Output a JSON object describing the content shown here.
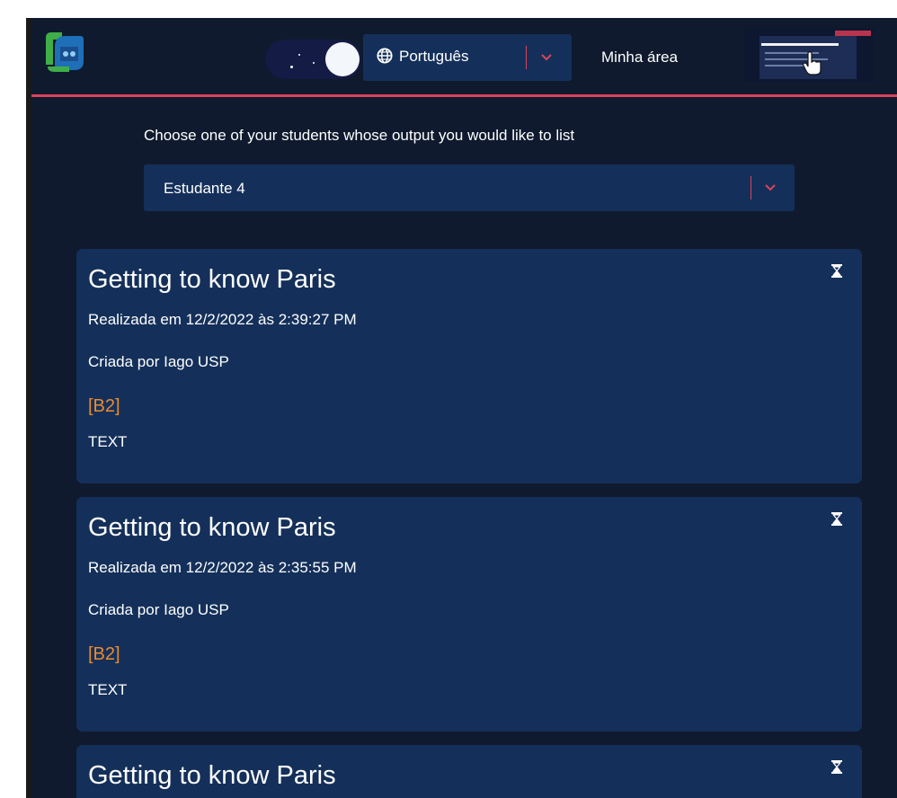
{
  "header": {
    "language": {
      "selected": "Português"
    },
    "nav_link": "Minha área"
  },
  "chooser": {
    "prompt": "Choose one of your students whose output you would like to list",
    "selected_student": "Estudante 4"
  },
  "activities": [
    {
      "title": "Getting to know Paris",
      "date": "Realizada em 12/2/2022 às 2:39:27 PM",
      "creator": "Criada por Iago USP",
      "level": "[B2]",
      "type": "TEXT"
    },
    {
      "title": "Getting to know Paris",
      "date": "Realizada em 12/2/2022 às 2:35:55 PM",
      "creator": "Criada por Iago USP",
      "level": "[B2]",
      "type": "TEXT"
    },
    {
      "title": "Getting to know Paris"
    }
  ],
  "icons": {
    "globe": "globe-icon",
    "chevron": "chevron-down-icon",
    "status": "hourglass-icon",
    "theme": "moon-icon"
  },
  "colors": {
    "background": "#0f1a2e",
    "panel": "#14305a",
    "accent": "#d9445c",
    "level": "#e98b2f"
  }
}
